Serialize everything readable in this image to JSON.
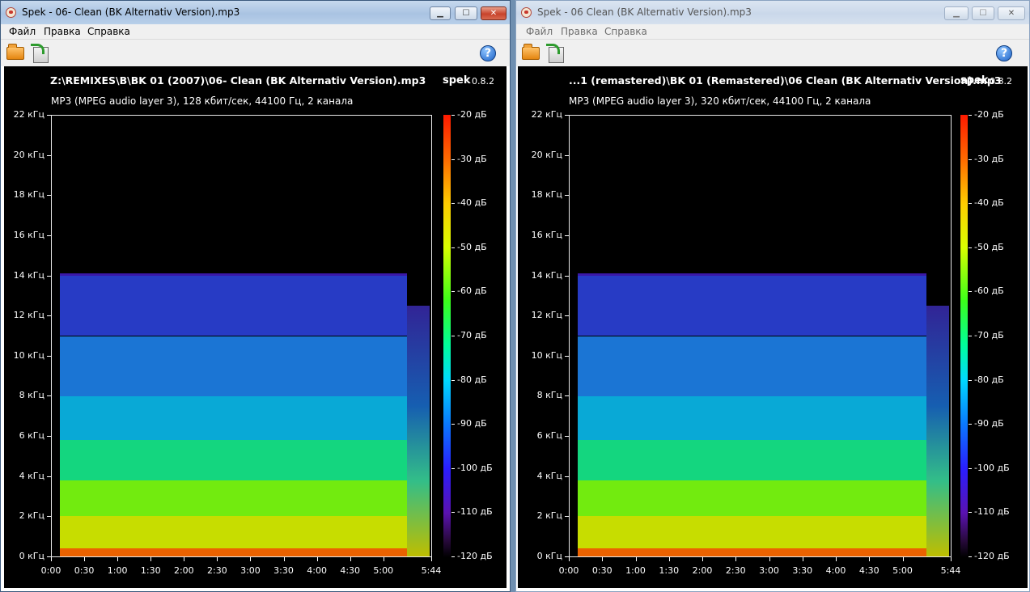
{
  "left": {
    "window_title": "Spek - 06- Clean (BK Alternativ Version).mp3",
    "menu": [
      "Файл",
      "Правка",
      "Справка"
    ],
    "file_name": "Z:\\REMIXES\\B\\BK 01 (2007)\\06- Clean (BK Alternativ Version).mp3",
    "file_info": "MP3 (MPEG audio layer 3), 128 кбит/сек, 44100 Гц, 2 канала",
    "app_name": "spek",
    "app_version": "0.8.2",
    "cutoff_khz": 14,
    "duration_label": "5:44"
  },
  "right": {
    "window_title": "Spek - 06 Clean (BK Alternativ Version).mp3",
    "menu": [
      "Файл",
      "Правка",
      "Справка"
    ],
    "file_name": "...1 (remastered)\\BK 01 (Remastered)\\06 Clean (BK Alternativ Version).mp3",
    "file_info": "MP3 (MPEG audio layer 3), 320 кбит/сек, 44100 Гц, 2 канала",
    "app_name": "spek",
    "app_version": "0.8.2",
    "cutoff_khz": 14,
    "duration_label": "5:44"
  },
  "window_controls": [
    "minimize-icon",
    "maximize-icon",
    "close-icon"
  ],
  "toolbar_icons": [
    "open-folder-icon",
    "save-icon",
    "help-icon"
  ],
  "help_glyph": "?",
  "control_glyphs": {
    "minimize": "▁",
    "maximize": "☐",
    "close": "✕"
  },
  "freq_labels": [
    "22 кГц",
    "20 кГц",
    "18 кГц",
    "16 кГц",
    "14 кГц",
    "12 кГц",
    "10 кГц",
    "8 кГц",
    "6 кГц",
    "4 кГц",
    "2 кГц",
    "0 кГц"
  ],
  "time_labels": [
    "0:00",
    "0:30",
    "1:00",
    "1:30",
    "2:00",
    "2:30",
    "3:00",
    "3:30",
    "4:00",
    "4:30",
    "5:00",
    "5:44"
  ],
  "db_labels": [
    "-20 дБ",
    "-30 дБ",
    "-40 дБ",
    "-50 дБ",
    "-60 дБ",
    "-70 дБ",
    "-80 дБ",
    "-90 дБ",
    "-100 дБ",
    "-110 дБ",
    "-120 дБ"
  ],
  "colors": {
    "titlebar_active": "#a9c3e2",
    "canvas_bg": "#000000",
    "db_max": "#ff1a00",
    "db_min": "#000000"
  }
}
